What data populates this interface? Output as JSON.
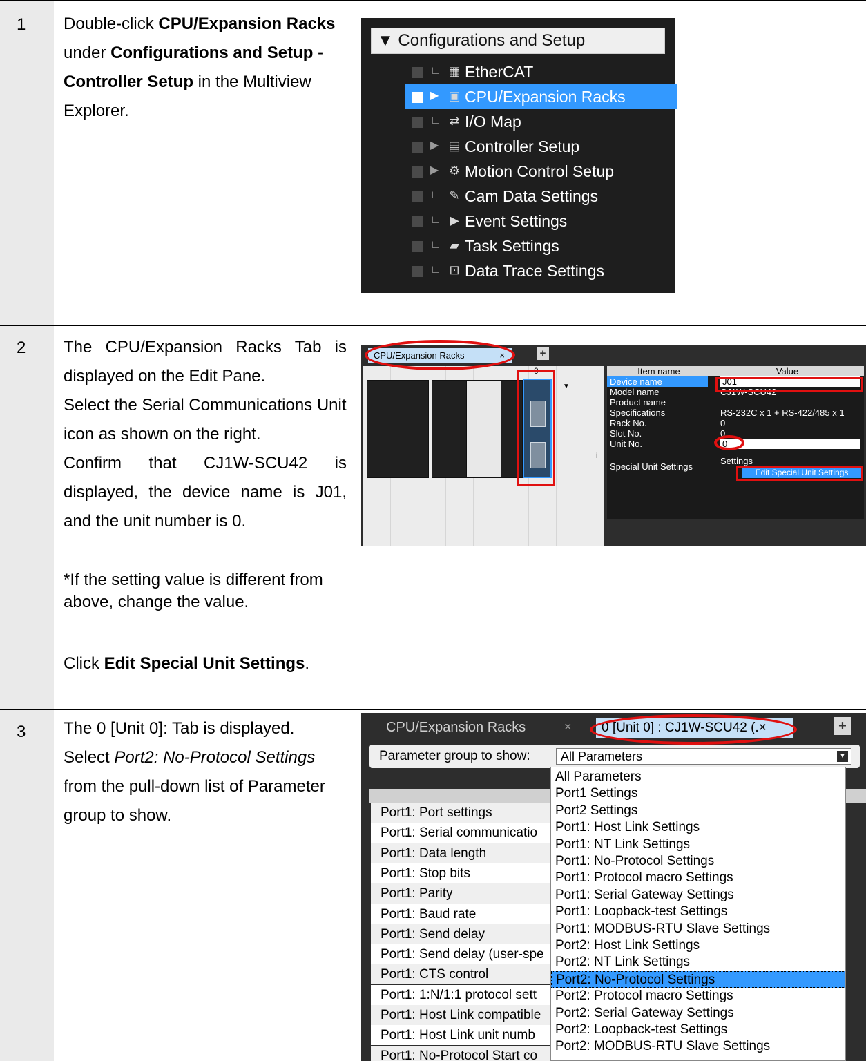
{
  "steps": [
    {
      "number": "1",
      "text": {
        "p1_a": "Double-click ",
        "p1_b": "CPU/Expansion Racks",
        "p1_c": " under ",
        "p1_d": "Configurations and Setup",
        "p1_e": " - ",
        "p1_f": "Controller Setup",
        "p1_g": " in the Multiview Explorer."
      }
    },
    {
      "number": "2",
      "text": {
        "l1": "The CPU/Expansion Racks Tab is displayed on the Edit Pane.",
        "l2": "Select the Serial Communications Unit icon as shown on the right.",
        "l3": "Confirm that CJ1W-SCU42 is displayed, the device name is J01, and the unit number is 0.",
        "note": "*If the setting value is different from above, change the value.",
        "click_a": "Click ",
        "click_b": "Edit Special Unit Settings",
        "click_c": "."
      }
    },
    {
      "number": "3",
      "text": {
        "l1": "The 0 [Unit 0]: Tab is displayed.",
        "l2_a": "Select ",
        "l2_b": "Port2: No-Protocol Settings",
        "l2_c": " from the pull-down list of Parameter group to show."
      }
    }
  ],
  "explorer": {
    "header": "▼ Configurations and Setup",
    "items": [
      {
        "label": "EtherCAT",
        "icon": "ethercat-icon",
        "expand": "∟"
      },
      {
        "label": "CPU/Expansion Racks",
        "icon": "rack-icon",
        "expand": "▶",
        "selected": true
      },
      {
        "label": "I/O Map",
        "icon": "io-map-icon",
        "expand": "∟"
      },
      {
        "label": "Controller Setup",
        "icon": "controller-setup-icon",
        "expand": "▶"
      },
      {
        "label": "Motion Control Setup",
        "icon": "gear-icon",
        "expand": "▶"
      },
      {
        "label": "Cam Data Settings",
        "icon": "cam-icon",
        "expand": "∟"
      },
      {
        "label": "Event Settings",
        "icon": "flag-icon",
        "expand": "∟"
      },
      {
        "label": "Task Settings",
        "icon": "task-icon",
        "expand": "∟"
      },
      {
        "label": "Data Trace Settings",
        "icon": "trace-icon",
        "expand": "∟"
      }
    ]
  },
  "rack_screen": {
    "tab_label": "CPU/Expansion Racks",
    "tab_close": "×",
    "unit_number_label": "0",
    "info_glyph": "i",
    "props_header": {
      "item": "Item name",
      "value": "Value"
    },
    "props": [
      {
        "key": "Device name",
        "value": "J01",
        "editable": true
      },
      {
        "key": "Model name",
        "value": "CJ1W-SCU42"
      },
      {
        "key": "Product name",
        "value": ""
      },
      {
        "key": "Specifications",
        "value": "RS-232C x 1 + RS-422/485 x 1"
      },
      {
        "key": "Rack No.",
        "value": "0"
      },
      {
        "key": "Slot No.",
        "value": "0"
      },
      {
        "key": "Unit No.",
        "value": "0",
        "editable": true
      }
    ],
    "special_label": "Special Unit Settings",
    "settings_text": "Settings",
    "edit_button": "Edit Special Unit Settings"
  },
  "unit_screen": {
    "tab1": "CPU/Expansion Racks",
    "tab1_close": "×",
    "tab2": "0 [Unit 0] : CJ1W-SCU42 (.×",
    "param_label": "Parameter group to show:",
    "param_value": "All Parameters",
    "left_rows": [
      "Port1: Port settings",
      "Port1: Serial communicatio",
      "Port1: Data length",
      "Port1: Stop bits",
      "Port1: Parity",
      "Port1: Baud rate",
      "Port1: Send delay",
      "Port1: Send delay (user-spe",
      "Port1: CTS control",
      "Port1: 1:N/1:1 protocol sett",
      "Port1: Host Link compatible",
      "Port1: Host Link unit numb",
      "Port1: No-Protocol Start co"
    ],
    "dropdown": [
      "All Parameters",
      "Port1 Settings",
      "Port2 Settings",
      "Port1: Host Link Settings",
      "Port1: NT Link Settings",
      "Port1: No-Protocol Settings",
      "Port1: Protocol macro Settings",
      "Port1: Serial Gateway Settings",
      "Port1: Loopback-test Settings",
      "Port1: MODBUS-RTU Slave Settings",
      "Port2: Host Link Settings",
      "Port2: NT Link Settings",
      "Port2: No-Protocol Settings",
      "Port2: Protocol macro Settings",
      "Port2: Serial Gateway Settings",
      "Port2: Loopback-test Settings",
      "Port2: MODBUS-RTU Slave Settings"
    ],
    "highlighted": "Port2: No-Protocol Settings"
  },
  "colors": {
    "selection": "#3399ff",
    "annotation": "#e01010",
    "panel_bg": "#1e1e1e"
  }
}
